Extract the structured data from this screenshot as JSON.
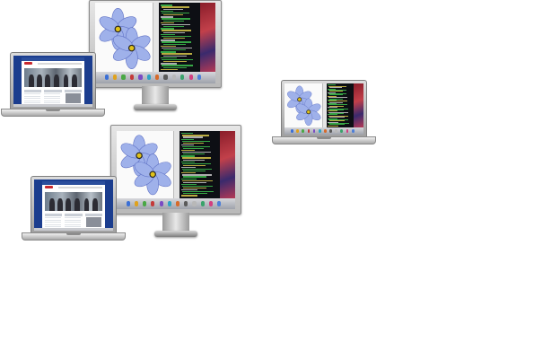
{
  "scene": {
    "description_items": [
      {
        "kind": "monitor",
        "name": "monitor-top"
      },
      {
        "kind": "laptop",
        "name": "laptop-top-left"
      },
      {
        "kind": "laptop",
        "name": "laptop-right"
      },
      {
        "kind": "monitor",
        "name": "monitor-bottom"
      },
      {
        "kind": "laptop",
        "name": "laptop-bottom-left"
      }
    ],
    "colors": {
      "petal": "#9fb1ea",
      "petal_edge": "#5d6fc4",
      "flower_center": "#e0c21a",
      "terminal_green": "#3fc24f",
      "terminal_yellow": "#d9c84a",
      "terminal_white": "#c9c9c9",
      "web_red": "#c8282e",
      "desktop_blue": "#1b3d8e"
    },
    "icons": [
      "apple-logo-icon",
      "dock-icon"
    ]
  }
}
